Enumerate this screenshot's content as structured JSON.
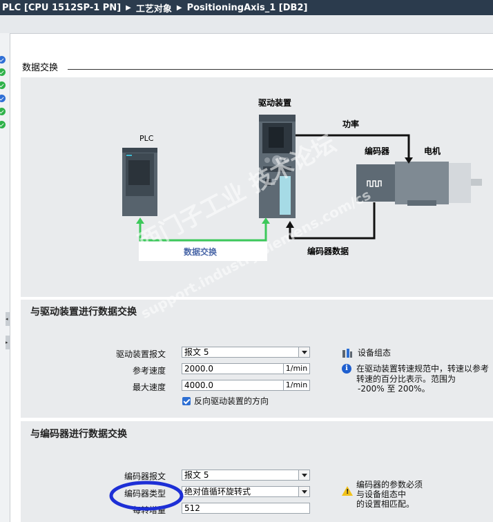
{
  "breadcrumb": {
    "root": "PLC [CPU 1512SP-1 PN]",
    "level2": "工艺对象",
    "level3": "PositioningAxis_1 [DB2]"
  },
  "section": {
    "title": "数据交换"
  },
  "diagram": {
    "plc_label": "PLC",
    "drive_label": "驱动装置",
    "power_label": "功率",
    "encoder_label": "编码器",
    "motor_label": "电机",
    "data_exchange_label": "数据交换",
    "encoder_data_label": "编码器数据"
  },
  "drive_exchange": {
    "title": "与驱动装置进行数据交换",
    "telegram_label": "驱动装置报文",
    "telegram_value": "报文 5",
    "ref_speed_label": "参考速度",
    "ref_speed_value": "2000.0",
    "ref_speed_unit": "1/min",
    "max_speed_label": "最大速度",
    "max_speed_value": "4000.0",
    "max_speed_unit": "1/min",
    "invert_label": "反向驱动装置的方向",
    "invert_checked": true,
    "device_config_label": "设备组态",
    "info_line1": "在驱动装置转速规范中，转速以参考",
    "info_line2": "转速的百分比表示。范围为",
    "info_line3": "-200% 至 200%。"
  },
  "encoder_exchange": {
    "title": "与编码器进行数据交换",
    "telegram_label": "编码器报文",
    "telegram_value": "报文 5",
    "type_label": "编码器类型",
    "type_value": "绝对值循环旋转式",
    "steps_label": "每转增量",
    "steps_value": "512",
    "warn_line1": "编码器的参数必须",
    "warn_line2": "与设备组态中",
    "warn_line3": "的设置相匹配。"
  },
  "watermark": {
    "line1": "西门子工业 技术论坛",
    "line2": "support.industry.siemens.com/cs"
  },
  "colors": {
    "titlebar": "#2b3b4d",
    "panel": "#e9ebed",
    "green_line": "#3cc85a",
    "annotation_circle": "#1d2fd6"
  }
}
